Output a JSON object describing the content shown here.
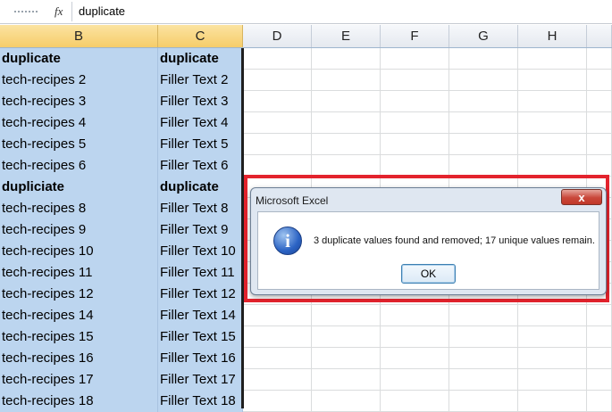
{
  "formula_bar": {
    "fx_label": "fx",
    "value": "duplicate"
  },
  "columns": [
    "B",
    "C",
    "D",
    "E",
    "F",
    "G",
    "H"
  ],
  "rows": [
    {
      "b": "duplicate",
      "c": "duplicate",
      "bold": true
    },
    {
      "b": "tech-recipes 2",
      "c": "Filler Text 2",
      "bold": false
    },
    {
      "b": "tech-recipes  3",
      "c": "Filler Text 3",
      "bold": false
    },
    {
      "b": "tech-recipes 4",
      "c": "Filler Text 4",
      "bold": false
    },
    {
      "b": "tech-recipes  5",
      "c": "Filler Text 5",
      "bold": false
    },
    {
      "b": "tech-recipes  6",
      "c": "Filler Text 6",
      "bold": false
    },
    {
      "b": "dupliciate",
      "c": "duplicate",
      "bold": true
    },
    {
      "b": "tech-recipes  8",
      "c": "Filler Text 8",
      "bold": false
    },
    {
      "b": "tech-recipes 9",
      "c": "Filler Text 9",
      "bold": false
    },
    {
      "b": "tech-recipes  10",
      "c": "Filler Text 10",
      "bold": false
    },
    {
      "b": "tech-recipes  11",
      "c": "Filler Text 11",
      "bold": false
    },
    {
      "b": "tech-recipes 12",
      "c": "Filler Text 12",
      "bold": false
    },
    {
      "b": "tech-recipes  14",
      "c": "Filler Text 14",
      "bold": false
    },
    {
      "b": "tech-recipes 15",
      "c": "Filler Text 15",
      "bold": false
    },
    {
      "b": "tech-recipes  16",
      "c": "Filler Text 16",
      "bold": false
    },
    {
      "b": "tech-recipes  17",
      "c": "Filler Text 17",
      "bold": false
    },
    {
      "b": "tech-recipes 18",
      "c": "Filler Text 18",
      "bold": false
    }
  ],
  "dialog": {
    "title": "Microsoft Excel",
    "close_label": "x",
    "icon": "info-icon",
    "icon_glyph": "i",
    "message": "3 duplicate values found and removed; 17 unique values remain.",
    "ok_label": "OK"
  },
  "colors": {
    "selection_fill": "#bcd5ef",
    "selected_header": "#f6cd6a",
    "highlight_border": "#e3232d"
  }
}
